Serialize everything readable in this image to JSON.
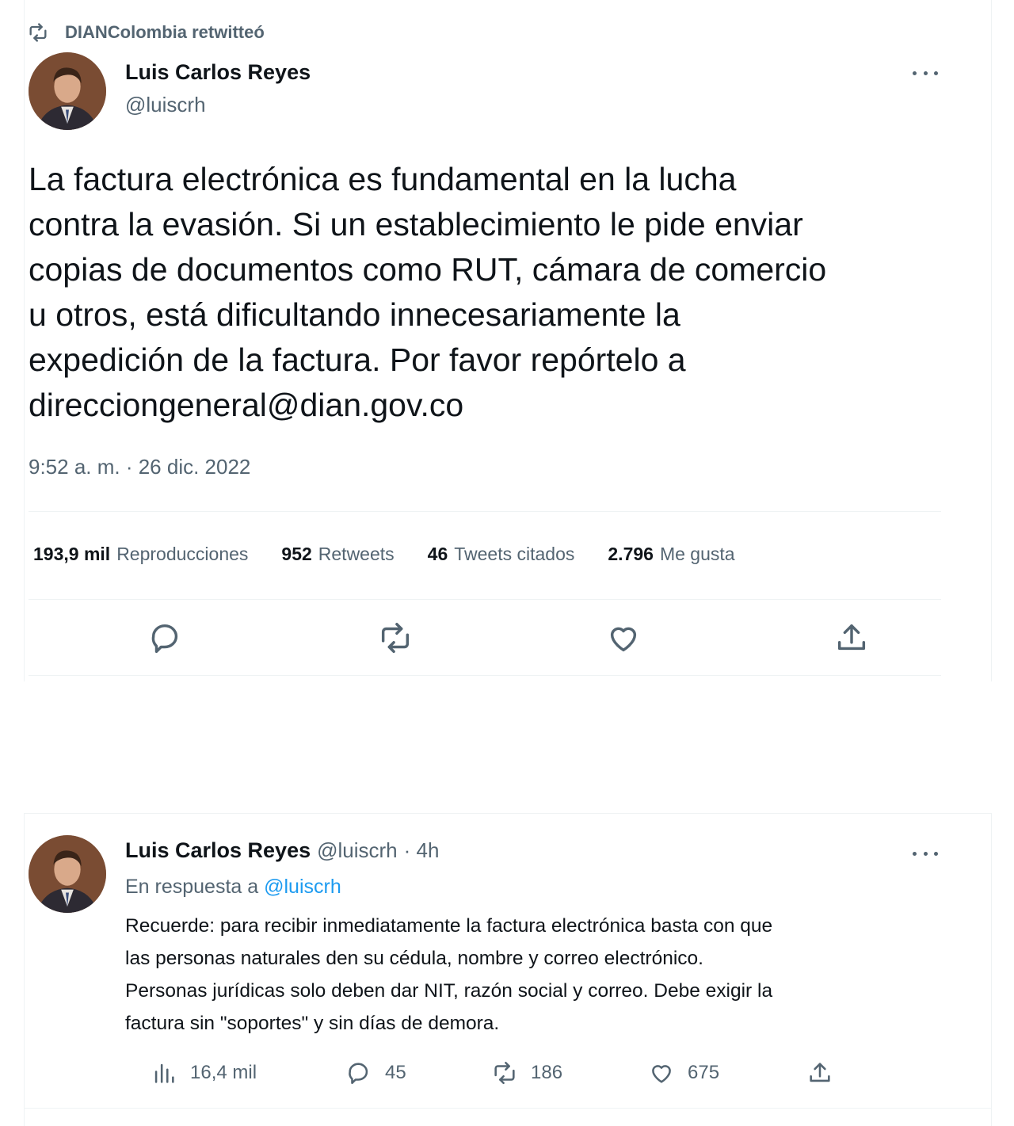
{
  "tweet1": {
    "retweet_context": "DIANColombia retwitteó",
    "author_name": "Luis Carlos Reyes",
    "author_handle": "@luiscrh",
    "text": "La factura electrónica es fundamental en la lucha\ncontra la evasión. Si un establecimiento le pide enviar\ncopias de documentos como RUT, cámara de comercio\nu otros, está dificultando innecesariamente la\nexpedición de la factura. Por favor repórtelo a\ndirecciongeneral@dian.gov.co",
    "timestamp": "9:52 a. m. · 26 dic. 2022",
    "stats": [
      {
        "value": "193,9 mil",
        "label": "Reproducciones"
      },
      {
        "value": "952",
        "label": "Retweets"
      },
      {
        "value": "46",
        "label": "Tweets citados"
      },
      {
        "value": "2.796",
        "label": "Me gusta"
      }
    ],
    "actions": [
      "reply-icon",
      "retweet-icon",
      "like-icon",
      "share-icon"
    ]
  },
  "tweet2": {
    "author_name": "Luis Carlos Reyes",
    "author_handle": "@luiscrh",
    "time_ago": "· 4h",
    "reply_prefix": "En respuesta a",
    "reply_to": "@luiscrh",
    "text": "Recuerde: para recibir inmediatamente la factura electrónica basta con que\nlas personas naturales den su cédula, nombre y correo electrónico.\nPersonas jurídicas solo deben dar NIT, razón social y correo. Debe exigir la\nfactura sin \"soportes\" y sin días de demora.",
    "metrics": {
      "views": "16,4 mil",
      "replies": "45",
      "retweets": "186",
      "likes": "675"
    }
  },
  "colors": {
    "text_primary": "#0f1419",
    "text_secondary": "#536471",
    "link": "#1d9bf0",
    "divider": "#eff3f4"
  }
}
